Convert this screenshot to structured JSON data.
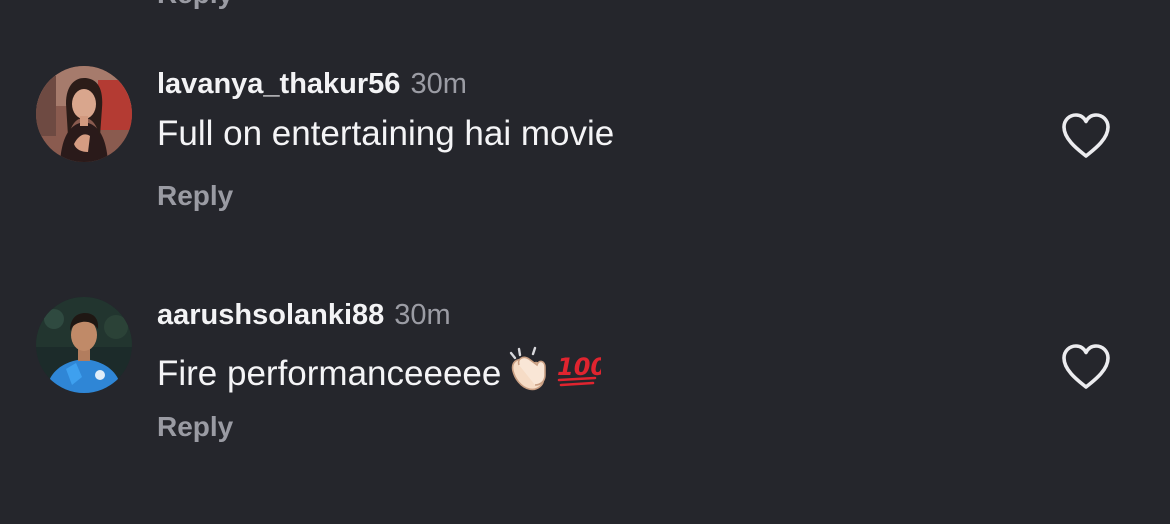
{
  "top_fragment": {
    "reply_label": "Reply"
  },
  "comments": [
    {
      "avatar": "woman-avatar",
      "username": "lavanya_thakur56",
      "time": "30m",
      "text": "Full on entertaining hai movie",
      "emojis": [],
      "reply_label": "Reply",
      "like_icon": "heart-outline-icon"
    },
    {
      "avatar": "man-in-blue-jersey-avatar",
      "username": "aarushsolanki88",
      "time": "30m",
      "text": "Fire performanceeeee",
      "emojis": [
        "clapping-hands-emoji",
        "hundred-points-emoji"
      ],
      "reply_label": "Reply",
      "like_icon": "heart-outline-icon"
    }
  ],
  "colors": {
    "background": "#25262c",
    "primary_text": "#f3f3f5",
    "secondary_text": "#9b9ca4",
    "hundred_emoji": "#e0242f"
  }
}
